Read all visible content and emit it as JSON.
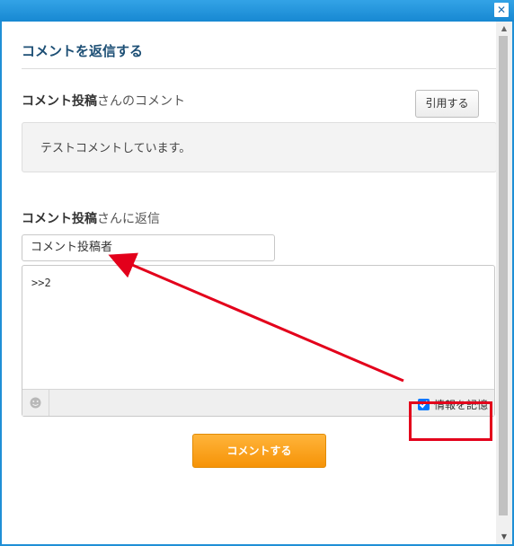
{
  "window": {
    "close_symbol": "✕"
  },
  "dialog": {
    "title": "コメントを返信する"
  },
  "original_comment": {
    "author": "コメント投稿",
    "suffix": "さんのコメント",
    "quote_button": "引用する",
    "text": "テストコメントしています。"
  },
  "reply": {
    "author": "コメント投稿",
    "suffix": "さんに返信",
    "name_value": "コメント投稿者",
    "body_value": ">>2",
    "remember_label": "情報を記憶",
    "remember_checked": true,
    "submit_label": "コメントする"
  },
  "icons": {
    "emoji": "smiley-icon",
    "close": "close-icon",
    "scroll_up": "scroll-up-icon",
    "scroll_down": "scroll-down-icon"
  },
  "colors": {
    "titlebar": "#1f8fd6",
    "heading": "#1d4f75",
    "submit": "#f69307",
    "annotation": "#e3001b"
  }
}
